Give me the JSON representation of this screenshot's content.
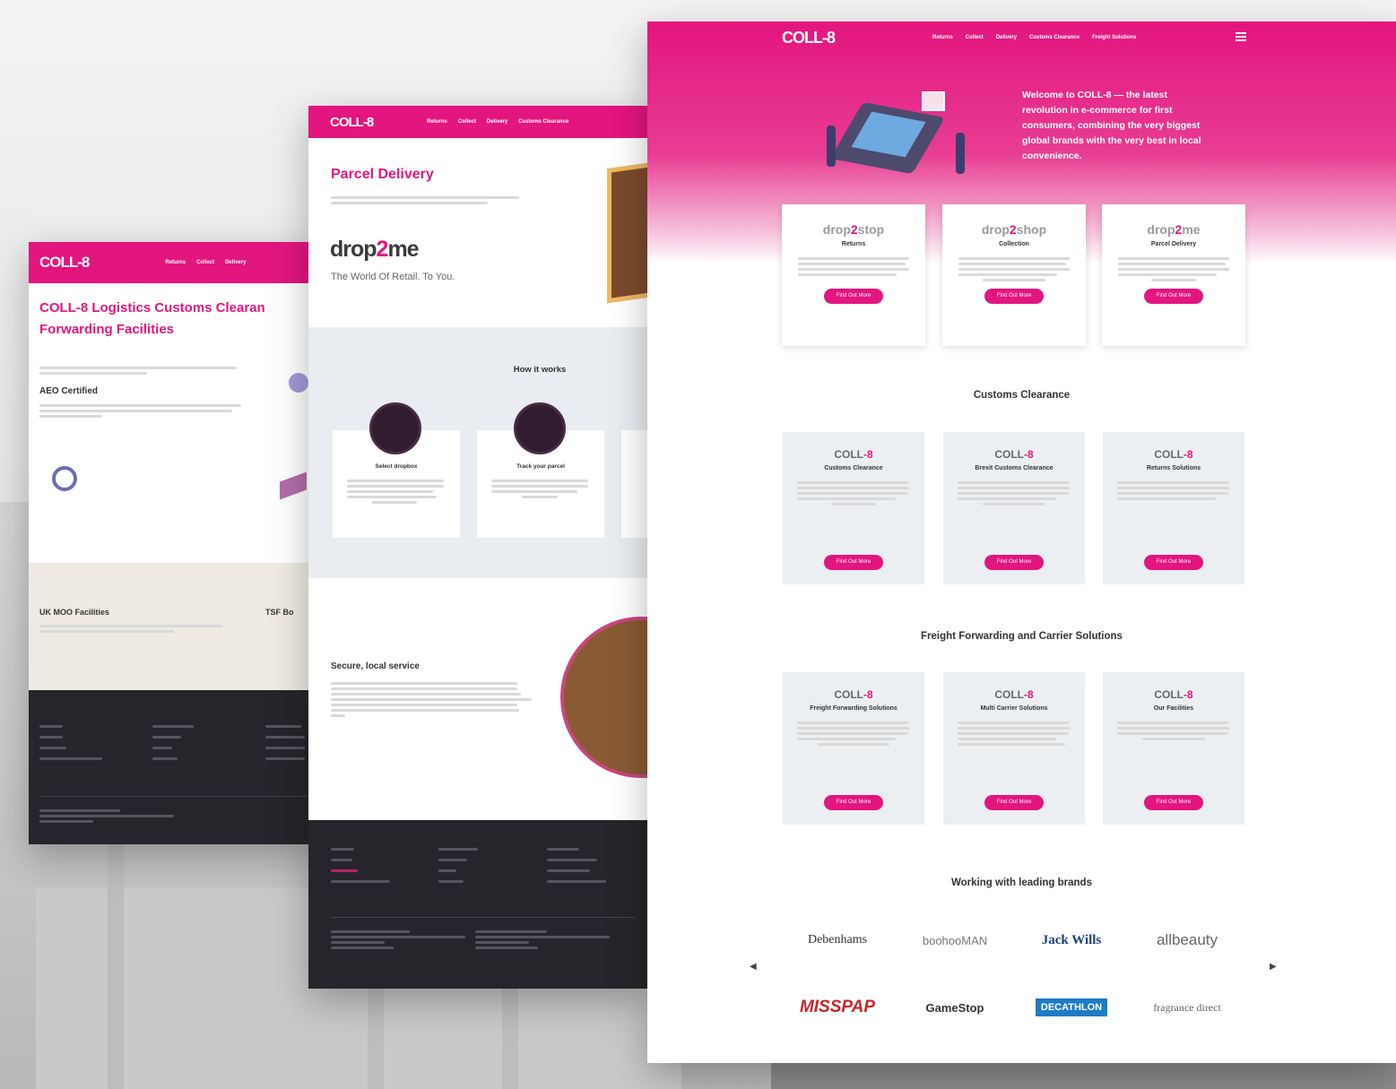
{
  "colors": {
    "brand_pink": "#e3157f",
    "dark_footer": "#25252b",
    "gray_section": "#eceff2"
  },
  "left": {
    "logo": "COLL-8",
    "nav": [
      "Returns",
      "Collect",
      "Delivery"
    ],
    "title": "COLL-8 Logistics Customs Clearan Forwarding Facilities",
    "aeo": "AEO Certified",
    "uk_moo": "UK MOO Facilities",
    "tsf": "TSF Bo"
  },
  "middle": {
    "logo": "COLL-8",
    "nav": [
      "Returns",
      "Collect",
      "Delivery",
      "Customs Clearance"
    ],
    "title": "Parcel Delivery",
    "drop2me_a": "drop",
    "drop2me_b": "2",
    "drop2me_c": "me",
    "tagline": "The World Of Retail. To You.",
    "how_title": "How it works",
    "how_cards": [
      "Select dropbox",
      "Track your parcel"
    ],
    "secure_title": "Secure, local service"
  },
  "right": {
    "logo": "COLL-8",
    "nav": [
      "Returns",
      "Collect",
      "Delivery",
      "Customs Clearance",
      "Freight Solutions"
    ],
    "hero_text": "Welcome to COLL-8 — the latest revolution in e-commerce for first consumers, combining the very biggest global brands with the very best in local convenience.",
    "drop_cards": [
      {
        "logo_a": "drop",
        "logo_b": "2",
        "logo_c": "stop",
        "title": "Returns",
        "button": "Find Out More"
      },
      {
        "logo_a": "drop",
        "logo_b": "2",
        "logo_c": "shop",
        "title": "Collection",
        "button": "Find Out More"
      },
      {
        "logo_a": "drop",
        "logo_b": "2",
        "logo_c": "me",
        "title": "Parcel Delivery",
        "button": "Find Out More"
      }
    ],
    "customs_title": "Customs Clearance",
    "customs_cards": [
      {
        "title": "Customs Clearance",
        "button": "Find Out More"
      },
      {
        "title": "Brexit Customs Clearance",
        "button": "Find Out More"
      },
      {
        "title": "Returns Solutions",
        "button": "Find Out More"
      }
    ],
    "freight_title": "Freight Forwarding and Carrier Solutions",
    "freight_cards": [
      {
        "title": "Freight Forwarding Solutions",
        "button": "Find Out More"
      },
      {
        "title": "Multi Carrier Solutions",
        "button": "Find Out More"
      },
      {
        "title": "Our Facilities",
        "button": "Find Out More"
      }
    ],
    "brands_title": "Working with leading brands",
    "brands": [
      "Debenhams",
      "boohooMAN",
      "Jack Wills",
      "allbeauty",
      "MISSPAP",
      "GameStop",
      "DECATHLON",
      "fragrance direct"
    ]
  }
}
